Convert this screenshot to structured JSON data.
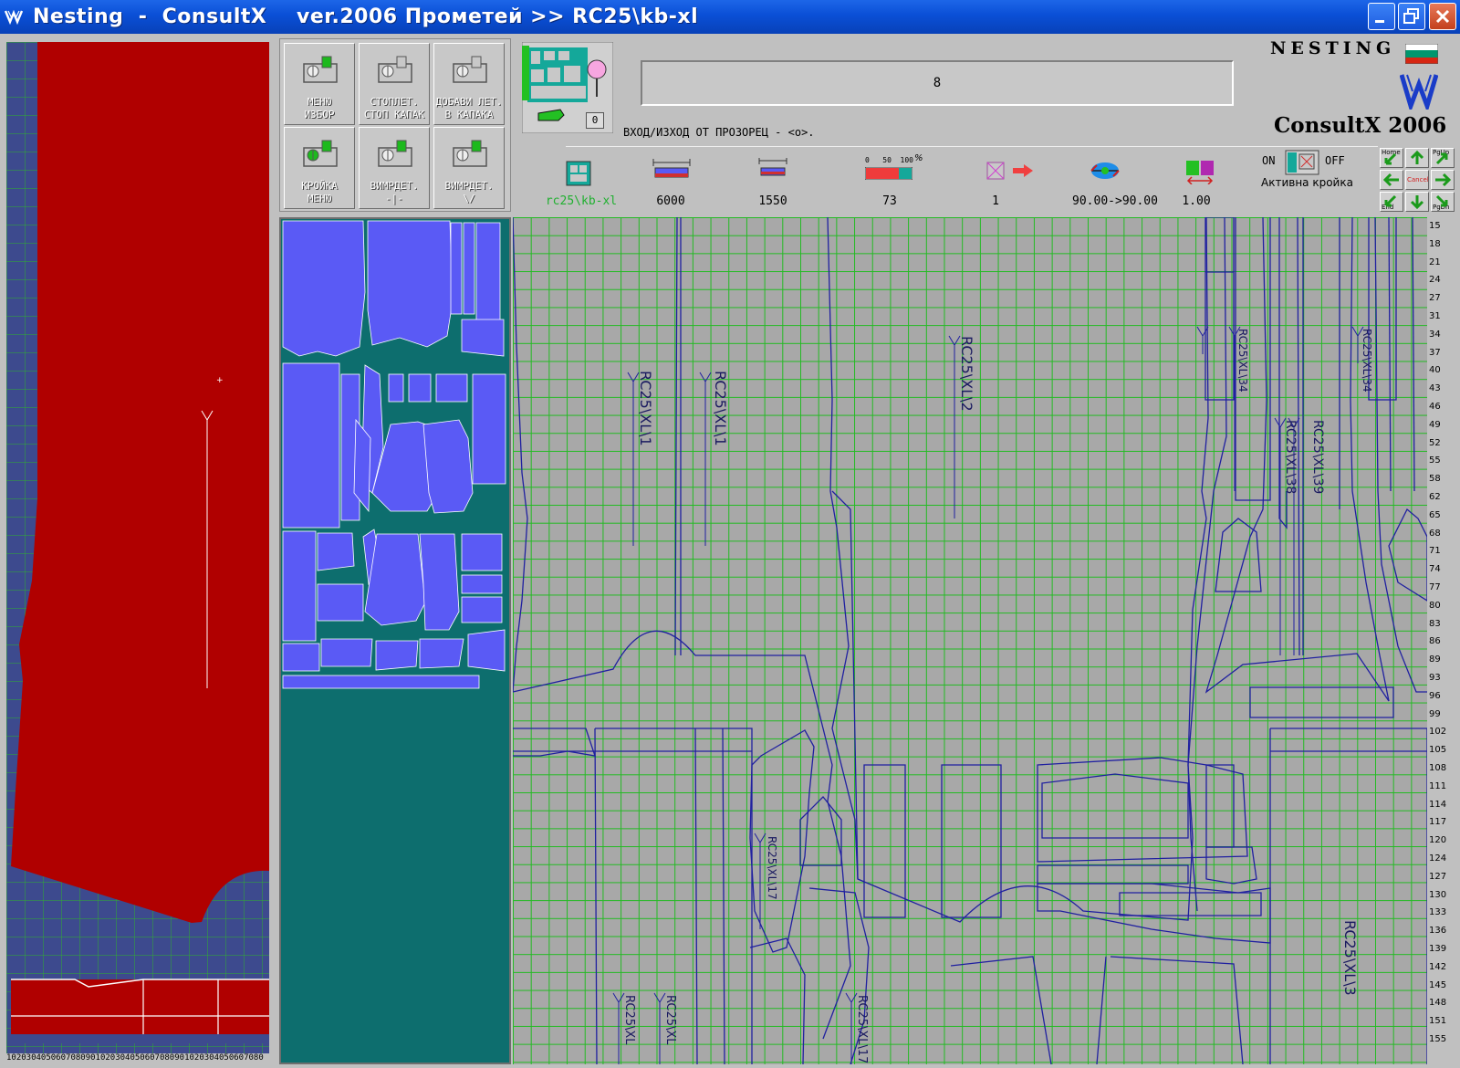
{
  "window": {
    "title": "Nesting  -  ConsultX    ver.2006 Прометей >> RC25\\kb-xl",
    "buttons": [
      "minimize",
      "maximize",
      "close"
    ]
  },
  "menu": {
    "buttons": [
      {
        "label": "МЕНЮ\nИЗБОР"
      },
      {
        "label": "СТОПЛЕТ.\nСТОП КАПАК"
      },
      {
        "label": "ДОБАВИ ЛЕТ.\nВ КАПАКА"
      },
      {
        "label": "КРОЙКА\nМЕНЮ"
      },
      {
        "label": "ВИМРДЕТ.\n-|-"
      },
      {
        "label": "ВИМРДЕТ.\n\\/"
      }
    ]
  },
  "header": {
    "counter": "0",
    "message": "8",
    "hint": "ВХОД/ИЗХОД ОТ ПРОЗОРЕЦ - <o>.",
    "brand_top": "NESTING",
    "brand_bottom": "ConsultX 2006"
  },
  "toolbar": {
    "file": "rc25\\kb-xl",
    "length": "6000",
    "width": "1550",
    "efficiency": "73",
    "efficiency_scale": "0   50  100",
    "efficiency_unit": "%",
    "count": "1",
    "rotation": "90.00->90.00",
    "scale": "1.00",
    "on_label": "ON",
    "off_label": "OFF",
    "active_label": "Активна кройка"
  },
  "navpad": {
    "home": "Home",
    "pgup": "PgUp",
    "end": "End",
    "pgdn": "PgDn",
    "cancel": "Cancel"
  },
  "ruler_ticks": [
    "15",
    "18",
    "21",
    "24",
    "27",
    "31",
    "34",
    "37",
    "40",
    "43",
    "46",
    "49",
    "52",
    "55",
    "58",
    "62",
    "65",
    "68",
    "71",
    "74",
    "77",
    "80",
    "83",
    "86",
    "89",
    "93",
    "96",
    "99",
    "102",
    "105",
    "108",
    "111",
    "114",
    "117",
    "120",
    "124",
    "127",
    "130",
    "133",
    "136",
    "139",
    "142",
    "145",
    "148",
    "151",
    "155"
  ],
  "bottom_ruler": "1020304050607080901020304050607080901020304050607080",
  "labels": {
    "p1a": "RC25\\XL\\1",
    "p1b": "RC25\\XL\\1",
    "p2": "RC25\\XL\\2",
    "p34a": "RC25\\XL\\34",
    "p34b": "RC25\\XL\\34",
    "p38": "RC25\\XL\\38",
    "p39": "RC25\\XL\\39",
    "p17": "RC25\\XL\\17",
    "p3": "RC25\\XL\\3",
    "pb1": "RC25\\XL",
    "pb2": "RC25\\XL",
    "pb3": "RC25\\XL\\17"
  },
  "colors": {
    "title_bar": "#0a4fd6",
    "left_fabric": "#b00000",
    "left_background": "#3d4a8e",
    "thumb_background": "#0d6e6e",
    "thumb_piece": "#5a5af5",
    "grid_line": "#22bb22",
    "piece_outline": "#2020a0",
    "work_background": "#a8a8a8"
  }
}
